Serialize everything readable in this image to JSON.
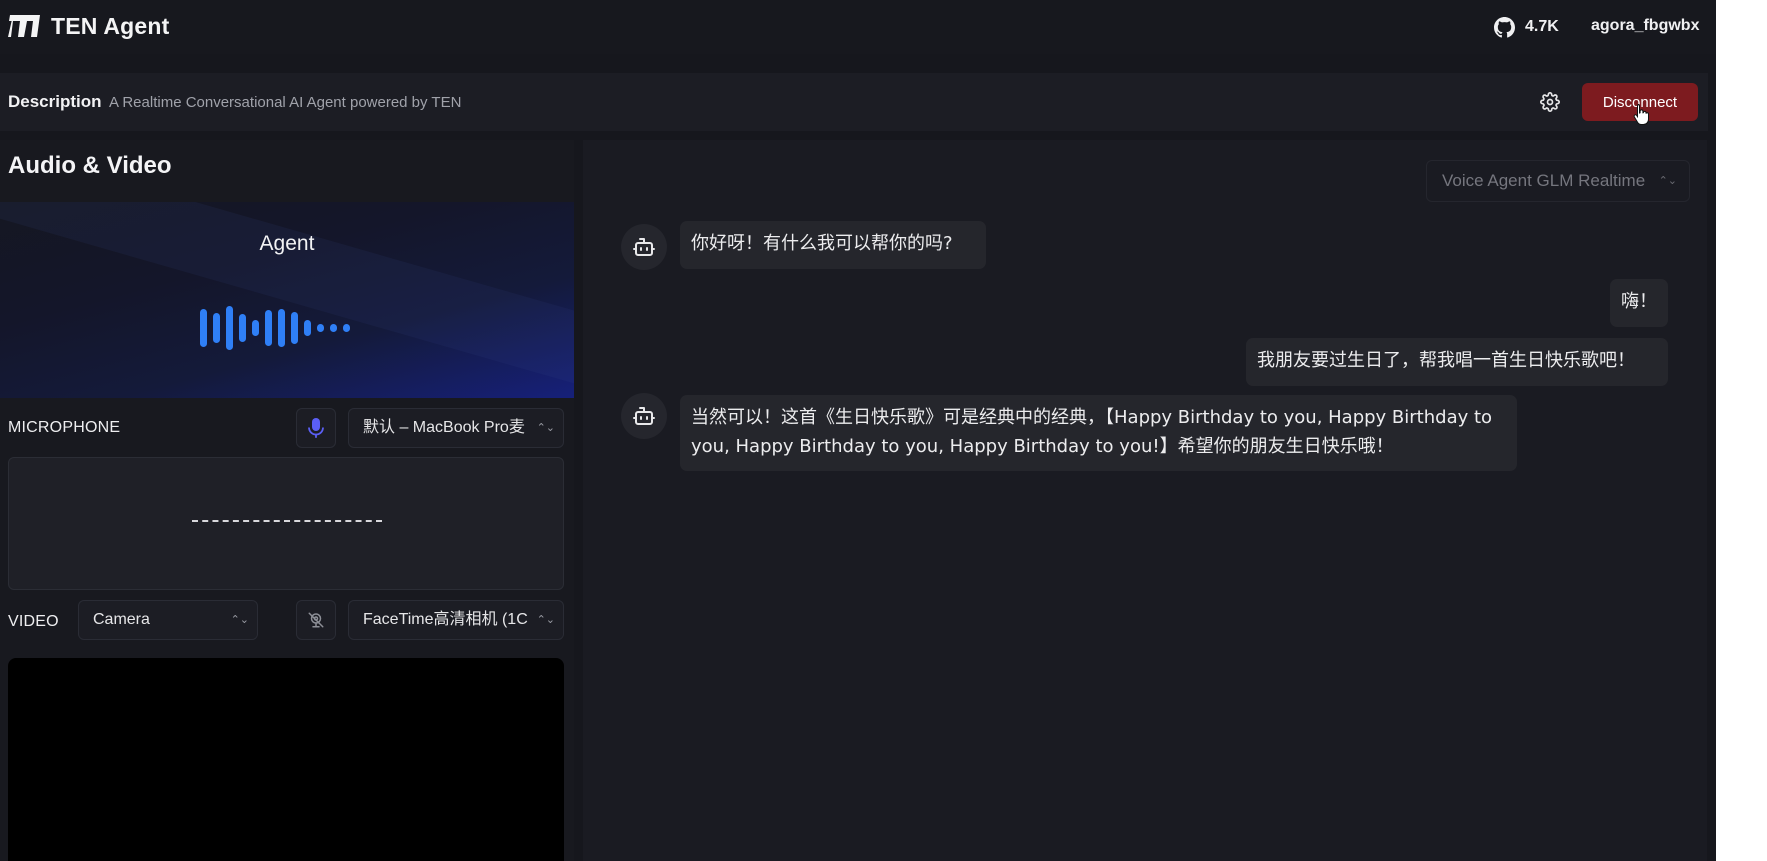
{
  "header": {
    "app_title": "TEN Agent",
    "github_stars": "4.7K",
    "username": "agora_fbgwbx",
    "logo_icon": "ten-logo-icon",
    "github_icon": "github-icon"
  },
  "description_bar": {
    "label": "Description",
    "text": "A Realtime Conversational AI Agent powered by TEN",
    "settings_icon": "gear-icon",
    "disconnect_label": "Disconnect"
  },
  "left_panel": {
    "title": "Audio & Video",
    "agent_label": "Agent",
    "microphone": {
      "label": "MICROPHONE",
      "device_value": "默认 – MacBook Pro麦",
      "mic_icon": "microphone-icon"
    },
    "video": {
      "label": "VIDEO",
      "source_value": "Camera",
      "camera_icon": "camera-off-icon",
      "device_value": "FaceTime高清相机 (1C"
    }
  },
  "chat": {
    "graph_select_value": "Voice Agent GLM Realtime",
    "messages": [
      {
        "role": "agent",
        "text": "你好呀！有什么我可以帮你的吗?"
      },
      {
        "role": "user",
        "text": "嗨！"
      },
      {
        "role": "user",
        "text": "我朋友要过生日了，帮我唱一首生日快乐歌吧！"
      },
      {
        "role": "agent",
        "text": "当然可以！这首《生日快乐歌》可是经典中的经典，【Happy Birthday to you, Happy Birthday to you, Happy Birthday to you, Happy Birthday to you!】希望你的朋友生日快乐哦！"
      }
    ]
  },
  "colors": {
    "background": "#16171d",
    "disconnect": "#7d1b1f",
    "waveform": "#2f7ff6",
    "mic_icon": "#5b5ff5"
  }
}
